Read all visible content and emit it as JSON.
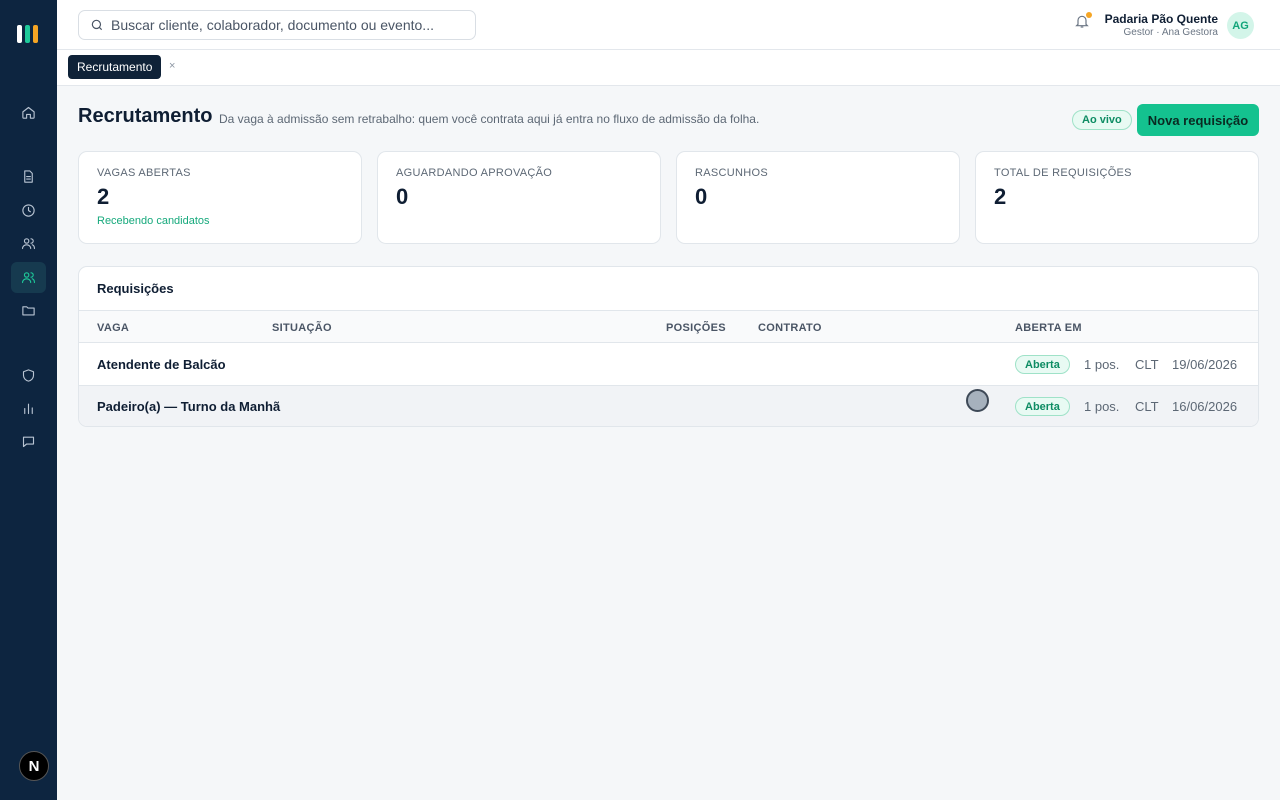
{
  "search": {
    "placeholder": "Buscar cliente, colaborador, documento ou evento..."
  },
  "user": {
    "company": "Padaria Pão Quente",
    "role": "Gestor · Ana Gestora",
    "initials": "AG"
  },
  "sidebar": {
    "logo_colors": [
      "#ffffff",
      "#1ec99a",
      "#f5a524"
    ],
    "items": [
      {
        "icon": "home-icon"
      },
      {
        "icon": "document-icon"
      },
      {
        "icon": "clock-icon"
      },
      {
        "icon": "users-icon"
      },
      {
        "icon": "recruit-users-icon",
        "active": true
      },
      {
        "icon": "folder-icon"
      },
      {
        "icon": "shield-icon"
      },
      {
        "icon": "bar-chart-icon"
      },
      {
        "icon": "message-icon"
      }
    ],
    "bottom_badge": "N"
  },
  "tabs": [
    {
      "label": "Recrutamento",
      "close": "×"
    }
  ],
  "page": {
    "title": "Recrutamento",
    "subtitle": "Da vaga à admissão sem retrabalho: quem você contrata aqui já entra no fluxo de admissão da folha.",
    "live_badge": "Ao vivo",
    "new_button": "Nova requisição"
  },
  "stats": [
    {
      "label": "VAGAS ABERTAS",
      "value": "2",
      "hint": "Recebendo candidatos"
    },
    {
      "label": "AGUARDANDO APROVAÇÃO",
      "value": "0",
      "hint": ""
    },
    {
      "label": "RASCUNHOS",
      "value": "0",
      "hint": ""
    },
    {
      "label": "TOTAL DE REQUISIÇÕES",
      "value": "2",
      "hint": ""
    }
  ],
  "table": {
    "title": "Requisições",
    "columns": [
      "VAGA",
      "SITUAÇÃO",
      "POSIÇÕES",
      "CONTRATO",
      "ABERTA EM"
    ],
    "rows": [
      {
        "vaga": "Atendente de Balcão",
        "situacao": "Aberta",
        "posicoes": "1 pos.",
        "contrato": "CLT",
        "aberta_em": "19/06/2026"
      },
      {
        "vaga": "Padeiro(a) — Turno da Manhã",
        "situacao": "Aberta",
        "posicoes": "1 pos.",
        "contrato": "CLT",
        "aberta_em": "16/06/2026"
      }
    ]
  },
  "colors": {
    "accent": "#14c28f",
    "sidebar": "#0d2540",
    "status_open": "#0d8c63"
  }
}
